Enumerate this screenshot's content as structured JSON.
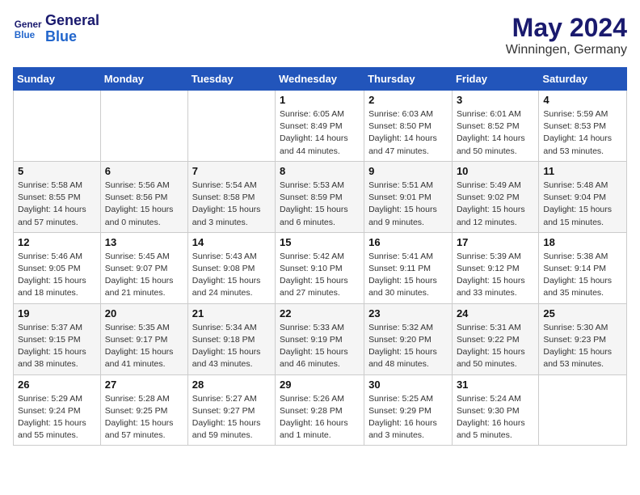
{
  "logo": {
    "line1": "General",
    "line2": "Blue"
  },
  "title": "May 2024",
  "location": "Winningen, Germany",
  "weekdays": [
    "Sunday",
    "Monday",
    "Tuesday",
    "Wednesday",
    "Thursday",
    "Friday",
    "Saturday"
  ],
  "weeks": [
    [
      null,
      null,
      null,
      {
        "day": "1",
        "sunrise": "Sunrise: 6:05 AM",
        "sunset": "Sunset: 8:49 PM",
        "daylight": "Daylight: 14 hours and 44 minutes."
      },
      {
        "day": "2",
        "sunrise": "Sunrise: 6:03 AM",
        "sunset": "Sunset: 8:50 PM",
        "daylight": "Daylight: 14 hours and 47 minutes."
      },
      {
        "day": "3",
        "sunrise": "Sunrise: 6:01 AM",
        "sunset": "Sunset: 8:52 PM",
        "daylight": "Daylight: 14 hours and 50 minutes."
      },
      {
        "day": "4",
        "sunrise": "Sunrise: 5:59 AM",
        "sunset": "Sunset: 8:53 PM",
        "daylight": "Daylight: 14 hours and 53 minutes."
      }
    ],
    [
      {
        "day": "5",
        "sunrise": "Sunrise: 5:58 AM",
        "sunset": "Sunset: 8:55 PM",
        "daylight": "Daylight: 14 hours and 57 minutes."
      },
      {
        "day": "6",
        "sunrise": "Sunrise: 5:56 AM",
        "sunset": "Sunset: 8:56 PM",
        "daylight": "Daylight: 15 hours and 0 minutes."
      },
      {
        "day": "7",
        "sunrise": "Sunrise: 5:54 AM",
        "sunset": "Sunset: 8:58 PM",
        "daylight": "Daylight: 15 hours and 3 minutes."
      },
      {
        "day": "8",
        "sunrise": "Sunrise: 5:53 AM",
        "sunset": "Sunset: 8:59 PM",
        "daylight": "Daylight: 15 hours and 6 minutes."
      },
      {
        "day": "9",
        "sunrise": "Sunrise: 5:51 AM",
        "sunset": "Sunset: 9:01 PM",
        "daylight": "Daylight: 15 hours and 9 minutes."
      },
      {
        "day": "10",
        "sunrise": "Sunrise: 5:49 AM",
        "sunset": "Sunset: 9:02 PM",
        "daylight": "Daylight: 15 hours and 12 minutes."
      },
      {
        "day": "11",
        "sunrise": "Sunrise: 5:48 AM",
        "sunset": "Sunset: 9:04 PM",
        "daylight": "Daylight: 15 hours and 15 minutes."
      }
    ],
    [
      {
        "day": "12",
        "sunrise": "Sunrise: 5:46 AM",
        "sunset": "Sunset: 9:05 PM",
        "daylight": "Daylight: 15 hours and 18 minutes."
      },
      {
        "day": "13",
        "sunrise": "Sunrise: 5:45 AM",
        "sunset": "Sunset: 9:07 PM",
        "daylight": "Daylight: 15 hours and 21 minutes."
      },
      {
        "day": "14",
        "sunrise": "Sunrise: 5:43 AM",
        "sunset": "Sunset: 9:08 PM",
        "daylight": "Daylight: 15 hours and 24 minutes."
      },
      {
        "day": "15",
        "sunrise": "Sunrise: 5:42 AM",
        "sunset": "Sunset: 9:10 PM",
        "daylight": "Daylight: 15 hours and 27 minutes."
      },
      {
        "day": "16",
        "sunrise": "Sunrise: 5:41 AM",
        "sunset": "Sunset: 9:11 PM",
        "daylight": "Daylight: 15 hours and 30 minutes."
      },
      {
        "day": "17",
        "sunrise": "Sunrise: 5:39 AM",
        "sunset": "Sunset: 9:12 PM",
        "daylight": "Daylight: 15 hours and 33 minutes."
      },
      {
        "day": "18",
        "sunrise": "Sunrise: 5:38 AM",
        "sunset": "Sunset: 9:14 PM",
        "daylight": "Daylight: 15 hours and 35 minutes."
      }
    ],
    [
      {
        "day": "19",
        "sunrise": "Sunrise: 5:37 AM",
        "sunset": "Sunset: 9:15 PM",
        "daylight": "Daylight: 15 hours and 38 minutes."
      },
      {
        "day": "20",
        "sunrise": "Sunrise: 5:35 AM",
        "sunset": "Sunset: 9:17 PM",
        "daylight": "Daylight: 15 hours and 41 minutes."
      },
      {
        "day": "21",
        "sunrise": "Sunrise: 5:34 AM",
        "sunset": "Sunset: 9:18 PM",
        "daylight": "Daylight: 15 hours and 43 minutes."
      },
      {
        "day": "22",
        "sunrise": "Sunrise: 5:33 AM",
        "sunset": "Sunset: 9:19 PM",
        "daylight": "Daylight: 15 hours and 46 minutes."
      },
      {
        "day": "23",
        "sunrise": "Sunrise: 5:32 AM",
        "sunset": "Sunset: 9:20 PM",
        "daylight": "Daylight: 15 hours and 48 minutes."
      },
      {
        "day": "24",
        "sunrise": "Sunrise: 5:31 AM",
        "sunset": "Sunset: 9:22 PM",
        "daylight": "Daylight: 15 hours and 50 minutes."
      },
      {
        "day": "25",
        "sunrise": "Sunrise: 5:30 AM",
        "sunset": "Sunset: 9:23 PM",
        "daylight": "Daylight: 15 hours and 53 minutes."
      }
    ],
    [
      {
        "day": "26",
        "sunrise": "Sunrise: 5:29 AM",
        "sunset": "Sunset: 9:24 PM",
        "daylight": "Daylight: 15 hours and 55 minutes."
      },
      {
        "day": "27",
        "sunrise": "Sunrise: 5:28 AM",
        "sunset": "Sunset: 9:25 PM",
        "daylight": "Daylight: 15 hours and 57 minutes."
      },
      {
        "day": "28",
        "sunrise": "Sunrise: 5:27 AM",
        "sunset": "Sunset: 9:27 PM",
        "daylight": "Daylight: 15 hours and 59 minutes."
      },
      {
        "day": "29",
        "sunrise": "Sunrise: 5:26 AM",
        "sunset": "Sunset: 9:28 PM",
        "daylight": "Daylight: 16 hours and 1 minute."
      },
      {
        "day": "30",
        "sunrise": "Sunrise: 5:25 AM",
        "sunset": "Sunset: 9:29 PM",
        "daylight": "Daylight: 16 hours and 3 minutes."
      },
      {
        "day": "31",
        "sunrise": "Sunrise: 5:24 AM",
        "sunset": "Sunset: 9:30 PM",
        "daylight": "Daylight: 16 hours and 5 minutes."
      },
      null
    ]
  ]
}
